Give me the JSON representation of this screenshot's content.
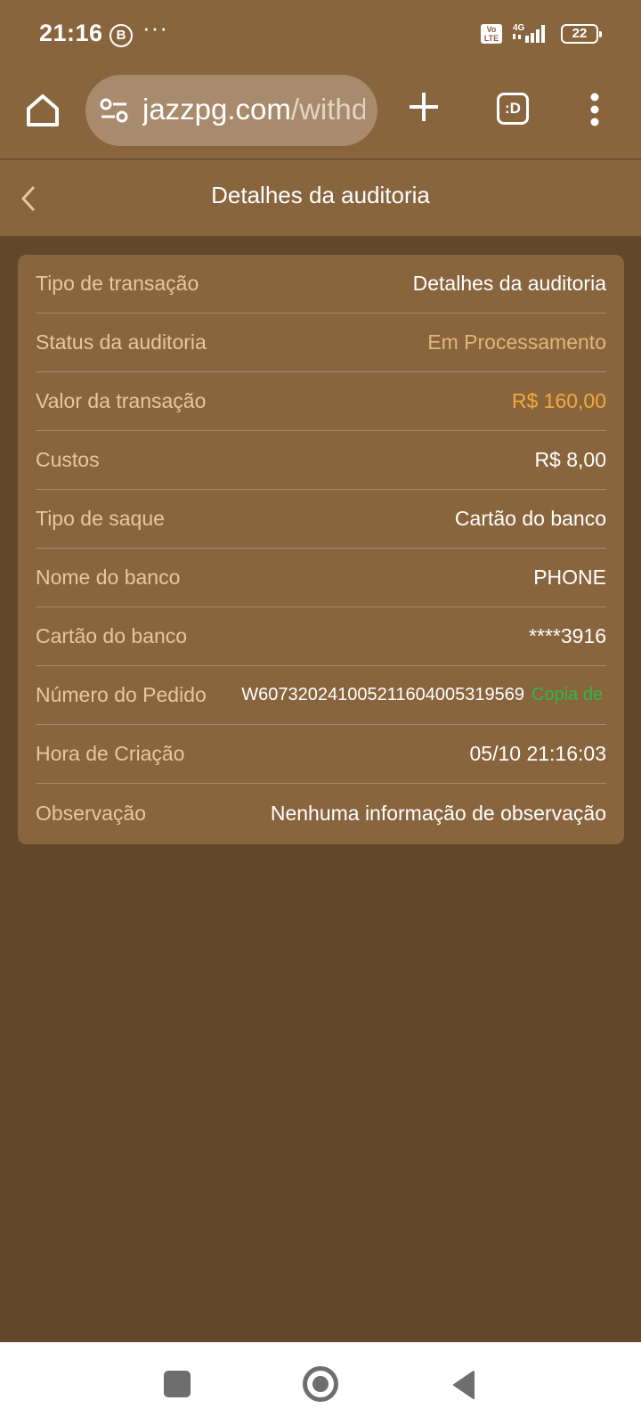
{
  "status_bar": {
    "time": "21:16",
    "b_badge": "B",
    "more": "···",
    "volte": "Vo LTE",
    "network": "4G",
    "battery": "22"
  },
  "browser": {
    "url_host": "jazzpg.com",
    "url_path": "/withd",
    "tabs_label": ":D"
  },
  "header": {
    "title": "Detalhes da auditoria"
  },
  "details": [
    {
      "label": "Tipo de transação",
      "value": "Detalhes da auditoria"
    },
    {
      "label": "Status da auditoria",
      "value": "Em Processamento"
    },
    {
      "label": "Valor da transação",
      "value": "R$ 160,00"
    },
    {
      "label": "Custos",
      "value": "R$ 8,00"
    },
    {
      "label": "Tipo de saque",
      "value": "Cartão do banco"
    },
    {
      "label": "Nome do banco",
      "value": "PHONE"
    },
    {
      "label": "Cartão do banco",
      "value": "****3916"
    },
    {
      "label": "Número do Pedido",
      "value": "W607320241005211604005319569",
      "action": "Copia de"
    },
    {
      "label": "Hora de Criação",
      "value": "05/10 21:16:03"
    },
    {
      "label": "Observação",
      "value": "Nenhuma informação de observação"
    }
  ],
  "colors": {
    "background": "#61482b",
    "card": "#89653e",
    "label": "#e8c79a",
    "amount": "#f2a93b",
    "copy_link": "#2fb84a"
  },
  "icons": {
    "home": "home-icon",
    "url_tune": "tune-icon",
    "new_tab": "plus-icon",
    "tabs": "tabs-icon",
    "menu": "more-vertical-icon",
    "back": "chevron-left-icon",
    "nav_recent": "square-icon",
    "nav_home": "circle-icon",
    "nav_back": "triangle-back-icon"
  }
}
